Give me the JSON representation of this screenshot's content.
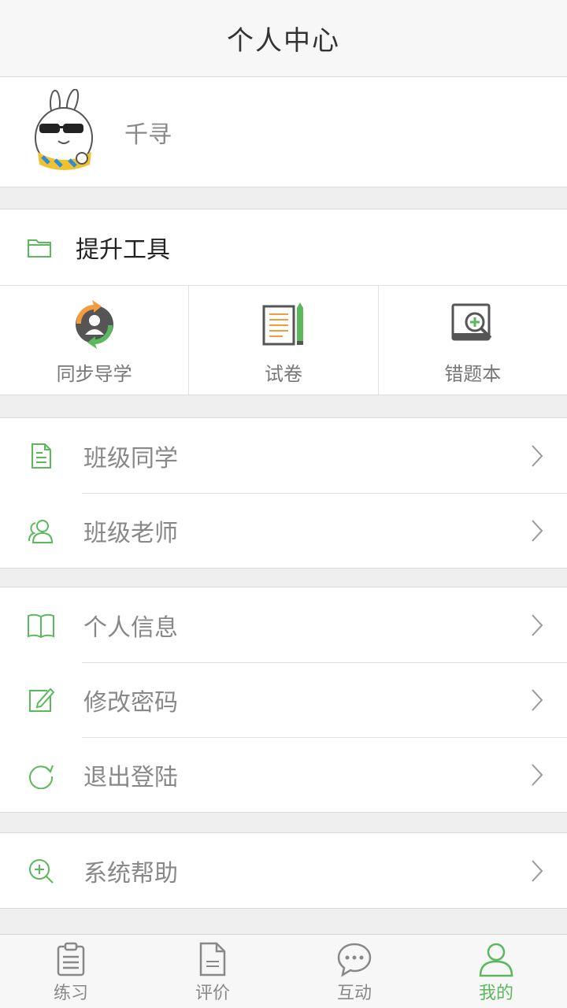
{
  "header": {
    "title": "个人中心"
  },
  "profile": {
    "name": "千寻"
  },
  "tools": {
    "title": "提升工具",
    "items": [
      {
        "label": "同步导学",
        "icon": "sync-guide-icon"
      },
      {
        "label": "试卷",
        "icon": "exam-paper-icon"
      },
      {
        "label": "错题本",
        "icon": "mistake-book-icon"
      }
    ]
  },
  "class_group": {
    "items": [
      {
        "label": "班级同学",
        "icon": "document-icon"
      },
      {
        "label": "班级老师",
        "icon": "users-icon"
      }
    ]
  },
  "account_group": {
    "items": [
      {
        "label": "个人信息",
        "icon": "book-icon"
      },
      {
        "label": "修改密码",
        "icon": "edit-icon"
      },
      {
        "label": "退出登陆",
        "icon": "refresh-icon"
      }
    ]
  },
  "help_group": {
    "items": [
      {
        "label": "系统帮助",
        "icon": "zoom-in-icon"
      }
    ]
  },
  "tabbar": {
    "items": [
      {
        "label": "练习",
        "icon": "clipboard-icon",
        "active": false
      },
      {
        "label": "评价",
        "icon": "document-icon",
        "active": false
      },
      {
        "label": "互动",
        "icon": "chat-bubble-icon",
        "active": false
      },
      {
        "label": "我的",
        "icon": "user-icon",
        "active": true
      }
    ]
  },
  "colors": {
    "accent": "#5cb85c",
    "text_muted": "#888888",
    "background": "#efefef"
  }
}
